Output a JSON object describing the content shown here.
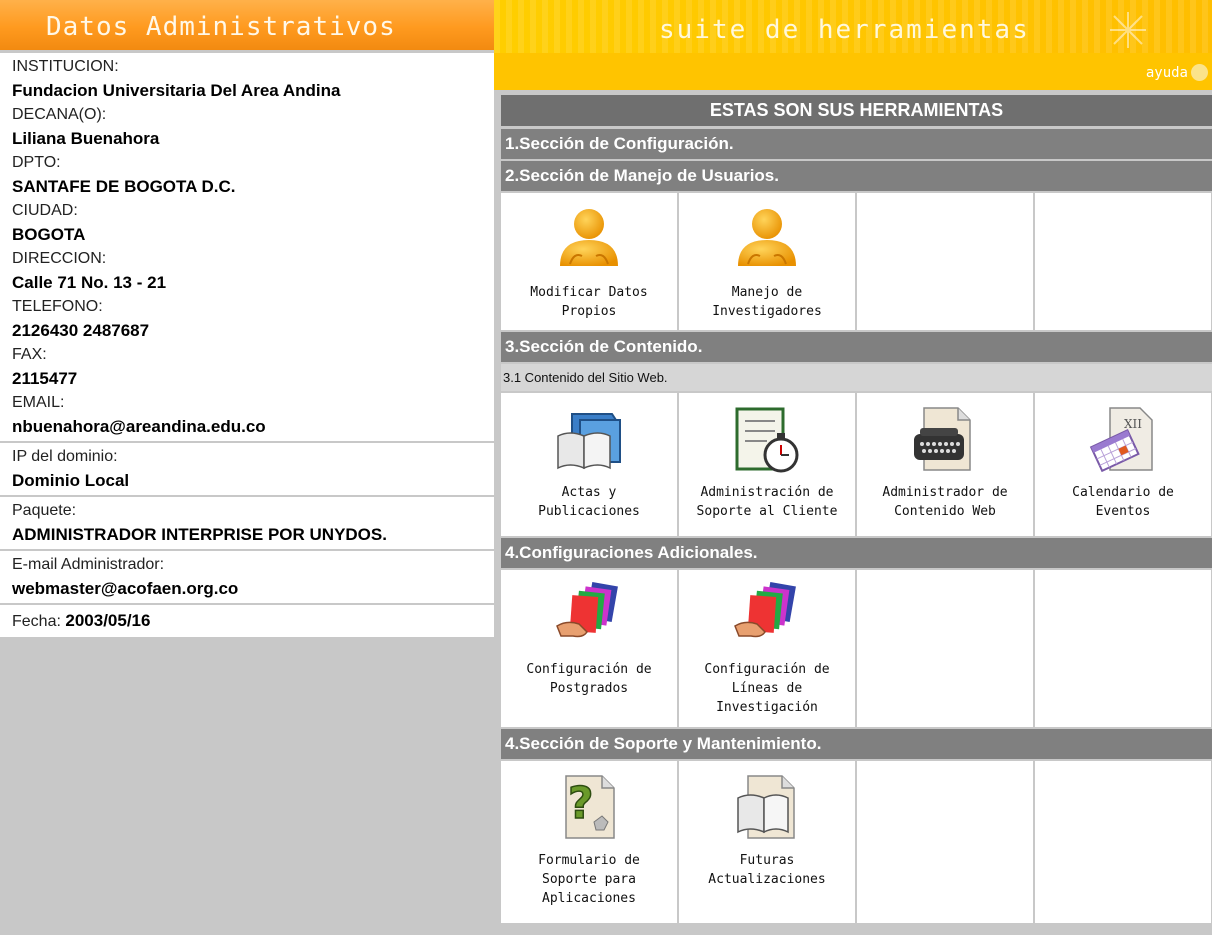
{
  "header": {
    "left_title": "Datos Administrativos",
    "right_title": "suite de herramientas",
    "help_label": "ayuda"
  },
  "info": {
    "institucion_label": "INSTITUCION:",
    "institucion_value": "Fundacion Universitaria Del Area Andina",
    "decano_label": "DECANA(O):",
    "decano_value": "Liliana Buenahora",
    "dpto_label": "DPTO:",
    "dpto_value": "SANTAFE DE BOGOTA D.C.",
    "ciudad_label": "CIUDAD:",
    "ciudad_value": "BOGOTA",
    "direccion_label": "DIRECCION:",
    "direccion_value": "Calle 71 No. 13 - 21",
    "telefono_label": "TELEFONO:",
    "telefono_value": "2126430 2487687",
    "fax_label": "FAX:",
    "fax_value": "2115477",
    "email_label": "EMAIL:",
    "email_value": "nbuenahora@areandina.edu.co",
    "ip_label": "IP del dominio:",
    "ip_value": "Dominio Local",
    "paquete_label": "Paquete:",
    "paquete_value": "ADMINISTRADOR INTERPRISE POR UNYDOS.",
    "email_admin_label": "E-mail Administrador:",
    "email_admin_value": "webmaster@acofaen.org.co",
    "fecha_label": "Fecha:",
    "fecha_value": "2003/05/16"
  },
  "tools": {
    "heading": "ESTAS SON SUS HERRAMIENTAS",
    "sec1": "1.Sección de Configuración.",
    "sec2": "2.Sección de Manejo de Usuarios.",
    "sec2_items": [
      {
        "line1": "Modificar Datos",
        "line2": "Propios",
        "icon": "user-icon"
      },
      {
        "line1": "Manejo de",
        "line2": "Investigadores",
        "icon": "user-icon"
      }
    ],
    "sec3": "3.Sección de Contenido.",
    "sec3_sub": "3.1 Contenido del Sitio Web.",
    "sec3_items": [
      {
        "line1": "Actas y",
        "line2": "Publicaciones",
        "icon": "folder-book-icon"
      },
      {
        "line1": "Administración de",
        "line2": "Soporte al Cliente",
        "icon": "checklist-stopwatch-icon"
      },
      {
        "line1": "Administrador de",
        "line2": "Contenido Web",
        "icon": "typewriter-icon"
      },
      {
        "line1": "Calendario de",
        "line2": "Eventos",
        "icon": "calendar-icon"
      }
    ],
    "sec4": "4.Configuraciones Adicionales.",
    "sec4_items": [
      {
        "line1": "Configuración de",
        "line2": "Postgrados",
        "line3": "",
        "icon": "colored-folders-icon"
      },
      {
        "line1": "Configuración de",
        "line2": "Líneas de",
        "line3": "Investigación",
        "icon": "colored-folders-icon"
      }
    ],
    "sec5": "4.Sección de Soporte y Mantenimiento.",
    "sec5_items": [
      {
        "line1": "Formulario de",
        "line2": "Soporte para",
        "line3": "Aplicaciones",
        "icon": "help-document-icon"
      },
      {
        "line1": "Futuras",
        "line2": "Actualizaciones",
        "line3": "",
        "icon": "open-book-icon"
      }
    ]
  }
}
